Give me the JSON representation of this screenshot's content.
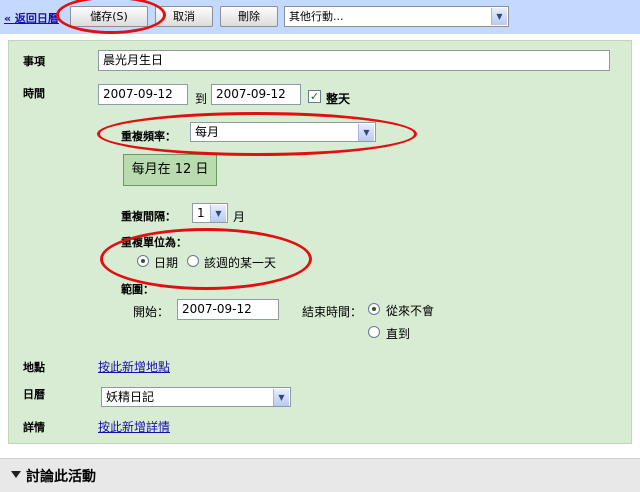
{
  "toolbar": {
    "back_label": "« 返回日曆",
    "save_label": "儲存(S)",
    "cancel_label": "取消",
    "delete_label": "刪除",
    "more_actions_value": "其他行動..."
  },
  "form": {
    "title_label": "事項",
    "title_value": "晨光月生日",
    "time_label": "時間",
    "start_date": "2007-09-12",
    "to_label": "到",
    "end_date": "2007-09-12",
    "all_day_label": "整天",
    "all_day_checked": true,
    "repeat_label": "重複頻率：",
    "repeat_value": "每月",
    "repeat_summary": "每月在 12 日",
    "interval_label": "重複間隔：",
    "interval_value": "1",
    "interval_unit": "月",
    "repeat_by_label": "重複單位為：",
    "repeat_by_options": [
      {
        "label": "日期",
        "checked": true
      },
      {
        "label": "該週的某一天",
        "checked": false
      }
    ],
    "range_label": "範圍：",
    "range_start_label": "開始：",
    "range_start_value": "2007-09-12",
    "range_end_label": "結束時間：",
    "range_end_options": [
      {
        "label": "從來不會",
        "checked": true
      },
      {
        "label": "直到",
        "checked": false
      }
    ],
    "where_label": "地點",
    "where_link": "按此新增地點",
    "calendar_label": "日曆",
    "calendar_value": "妖精日記",
    "details_label": "詳情",
    "details_link": "按此新增詳情"
  },
  "discussion": {
    "title": "討論此活動"
  },
  "colors": {
    "toolbar_bg": "#c3d9ff",
    "panel_bg": "#d8ecd4",
    "annotation_red": "#e01010",
    "link": "#1a0dab"
  }
}
